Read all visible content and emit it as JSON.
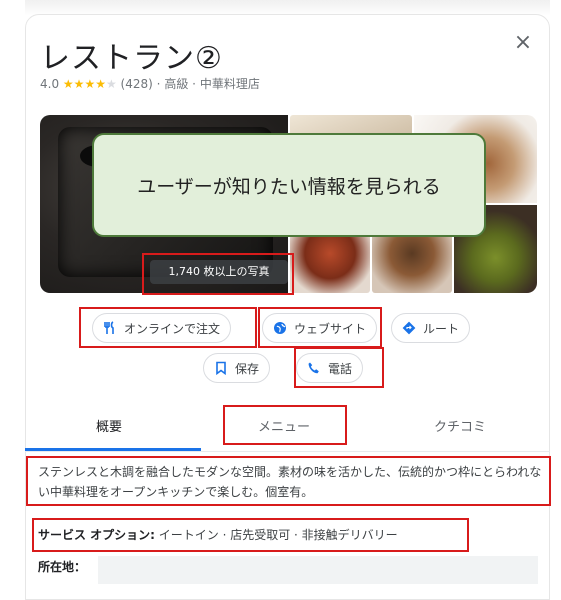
{
  "header": {
    "title": "レストラン②",
    "close_label": "×",
    "rating": "4.0",
    "stars_filled": "★★★★",
    "stars_empty": "★",
    "review_count": "(428)",
    "sep1": "·",
    "price": "高級",
    "sep2": "·",
    "category": "中華料理店"
  },
  "photos": {
    "count_label": "1,740 枚以上の写真"
  },
  "callout": {
    "text": "ユーザーが知りたい情報を見られる"
  },
  "actions": {
    "order_online": "オンラインで注文",
    "website": "ウェブサイト",
    "route": "ルート",
    "save": "保存",
    "call": "電話"
  },
  "tabs": [
    {
      "label": "概要"
    },
    {
      "label": "メニュー"
    },
    {
      "label": "クチコミ"
    }
  ],
  "description": "ステンレスと木調を融合したモダンな空間。素材の味を活かした、伝統的かつ枠にとらわれない中華料理をオープンキッチンで楽しむ。個室有。",
  "service": {
    "label": "サービス オプション:",
    "value": " イートイン · 店先受取可 · 非接触デリバリー"
  },
  "address": {
    "label": "所在地："
  },
  "colors": {
    "accent": "#1a73e8",
    "highlight": "#d81b1b",
    "callout_bg": "#e2efda",
    "callout_border": "#4e7a3a",
    "star": "#fbbc04"
  }
}
